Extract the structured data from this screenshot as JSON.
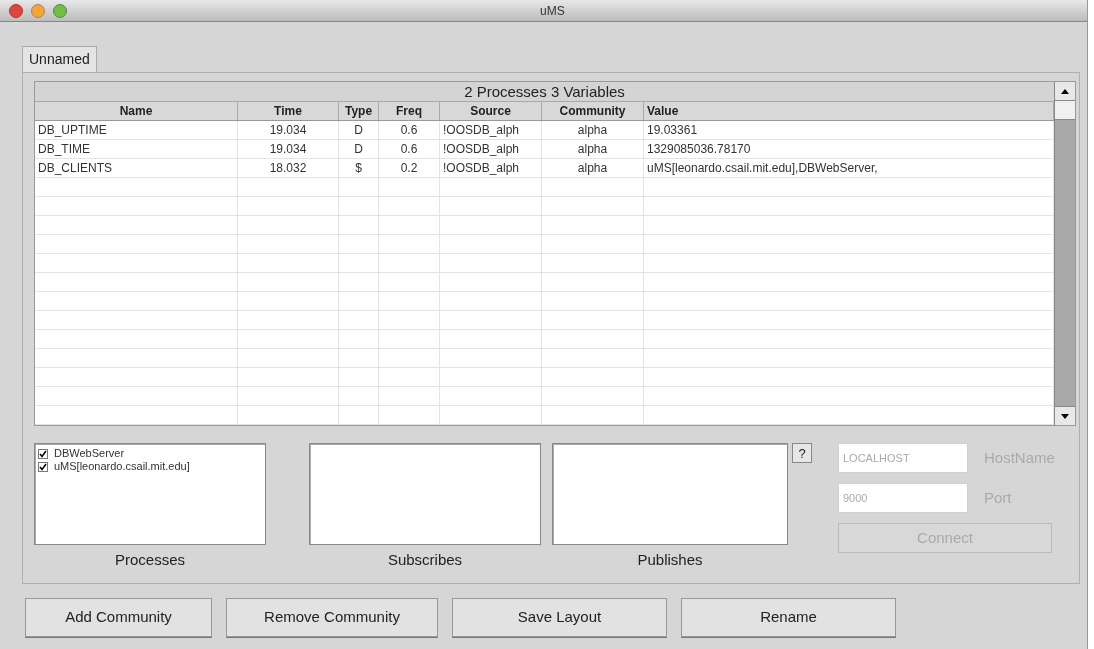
{
  "window": {
    "title": "uMS"
  },
  "tabs": [
    {
      "label": "Unnamed",
      "selected": true
    }
  ],
  "table": {
    "caption": "2 Processes 3 Variables",
    "columns": [
      "Name",
      "Time",
      "Type",
      "Freq",
      "Source",
      "Community",
      "Value"
    ],
    "rows": [
      [
        "DB_UPTIME",
        "19.034",
        "D",
        "0.6",
        "!OOSDB_alph",
        "alpha",
        "19.03361"
      ],
      [
        "DB_TIME",
        "19.034",
        "D",
        "0.6",
        "!OOSDB_alph",
        "alpha",
        "1329085036.78170"
      ],
      [
        "DB_CLIENTS",
        "18.032",
        "$",
        "0.2",
        "!OOSDB_alph",
        "alpha",
        "uMS[leonardo.csail.mit.edu],DBWebServer,"
      ]
    ]
  },
  "processes": {
    "label": "Processes",
    "items": [
      {
        "name": "DBWebServer",
        "checked": true
      },
      {
        "name": "uMS[leonardo.csail.mit.edu]",
        "checked": true
      }
    ]
  },
  "subscribes": {
    "label": "Subscribes"
  },
  "publishes": {
    "label": "Publishes"
  },
  "help_button": "?",
  "connection": {
    "hostname": {
      "value": "LOCALHOST",
      "label": "HostName",
      "disabled": true
    },
    "port": {
      "value": "9000",
      "label": "Port",
      "disabled": true
    },
    "connect": {
      "label": "Connect",
      "disabled": true
    }
  },
  "buttons": [
    "Add Community",
    "Remove Community",
    "Save Layout",
    "Rename"
  ]
}
